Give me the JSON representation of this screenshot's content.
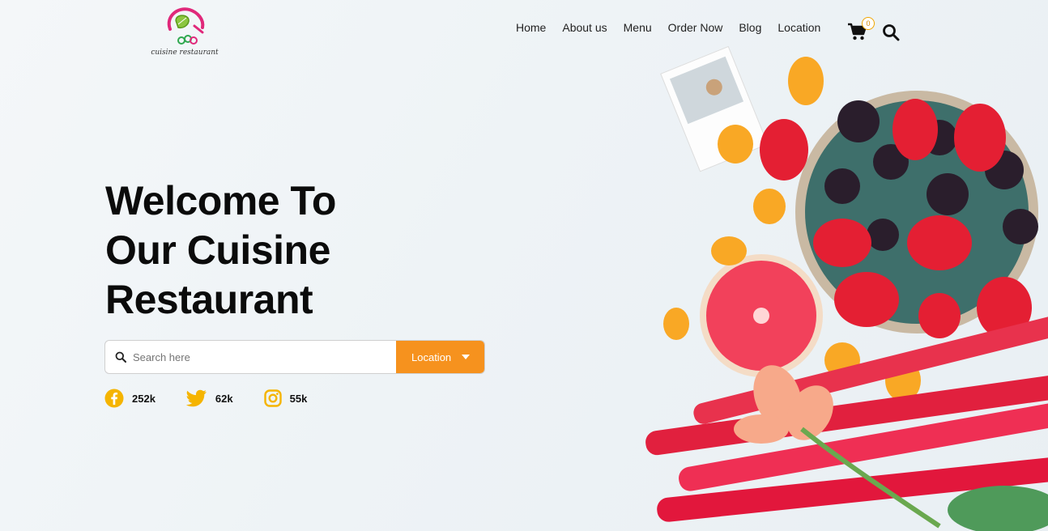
{
  "brand": {
    "logo_text": "cuisine restaurant"
  },
  "nav": {
    "items": [
      "Home",
      "About us",
      "Menu",
      "Order Now",
      "Blog",
      "Location"
    ],
    "cart_count": "0"
  },
  "hero": {
    "title_lines": [
      "Welcome To",
      "Our Cuisine",
      "Restaurant"
    ]
  },
  "search": {
    "placeholder": "Search here",
    "location_label": "Location"
  },
  "social": [
    {
      "icon": "facebook-icon",
      "count": "252k"
    },
    {
      "icon": "twitter-icon",
      "count": "62k"
    },
    {
      "icon": "instagram-icon",
      "count": "55k"
    }
  ],
  "colors": {
    "accent": "#f6921e",
    "icon_yellow": "#f5b400",
    "text_dark": "#0b0b0b"
  }
}
